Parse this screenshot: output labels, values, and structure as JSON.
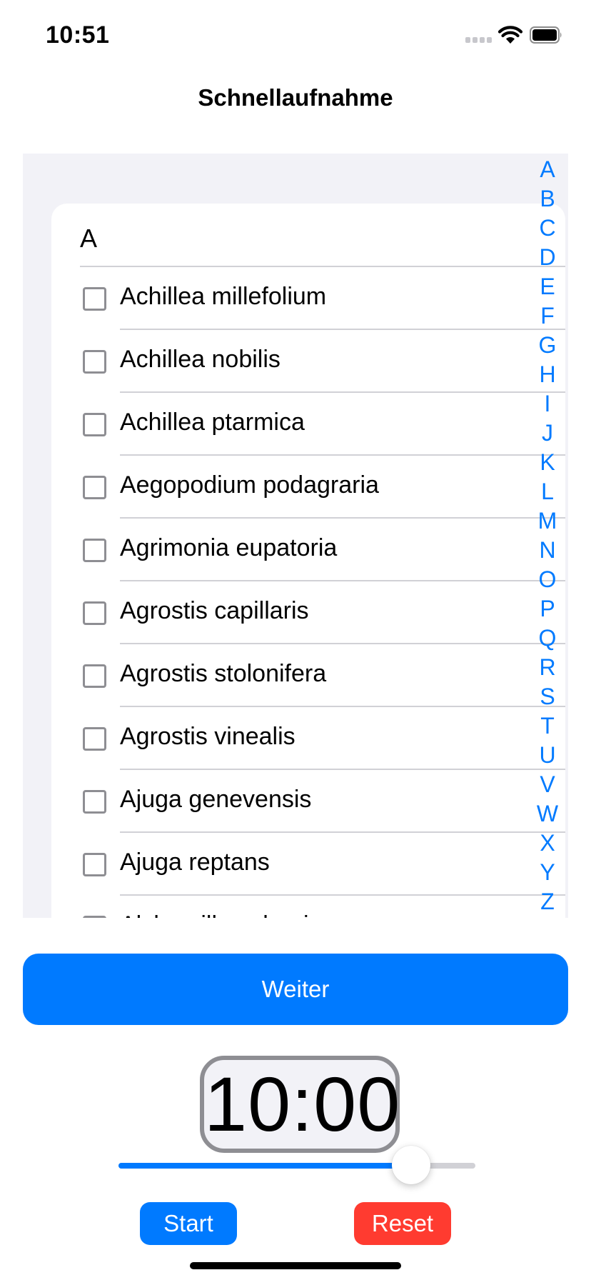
{
  "status_bar": {
    "time": "10:51"
  },
  "nav": {
    "title": "Schnellaufnahme"
  },
  "list": {
    "section_header": "A",
    "items": [
      {
        "label": "Achillea millefolium",
        "checked": false
      },
      {
        "label": "Achillea nobilis",
        "checked": false
      },
      {
        "label": "Achillea ptarmica",
        "checked": false
      },
      {
        "label": "Aegopodium podagraria",
        "checked": false
      },
      {
        "label": "Agrimonia eupatoria",
        "checked": false
      },
      {
        "label": "Agrostis capillaris",
        "checked": false
      },
      {
        "label": "Agrostis stolonifera",
        "checked": false
      },
      {
        "label": "Agrostis vinealis",
        "checked": false
      },
      {
        "label": "Ajuga genevensis",
        "checked": false
      },
      {
        "label": "Ajuga reptans",
        "checked": false
      },
      {
        "label": "Alchemilla vulgaris",
        "checked": false
      }
    ],
    "index_letters": [
      "A",
      "B",
      "C",
      "D",
      "E",
      "F",
      "G",
      "H",
      "I",
      "J",
      "K",
      "L",
      "M",
      "N",
      "O",
      "P",
      "Q",
      "R",
      "S",
      "T",
      "U",
      "V",
      "W",
      "X",
      "Y",
      "Z"
    ]
  },
  "actions": {
    "weiter_label": "Weiter"
  },
  "timer": {
    "display": "10:00",
    "slider_fraction": 0.82
  },
  "controls": {
    "start_label": "Start",
    "reset_label": "Reset"
  },
  "colors": {
    "accent": "#007aff",
    "destructive": "#ff3b30",
    "list_background": "#f2f2f7"
  }
}
